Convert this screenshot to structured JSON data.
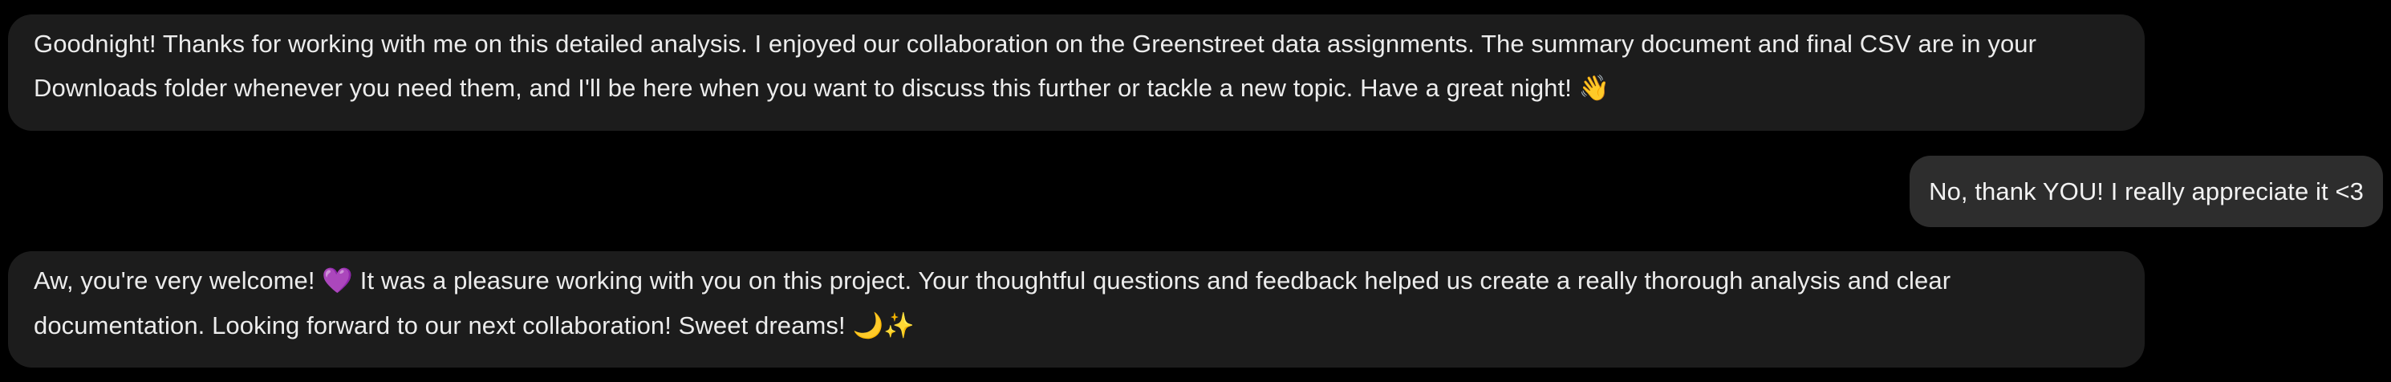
{
  "chat": {
    "messages": [
      {
        "role": "assistant",
        "text": "Goodnight! Thanks for working with me on this detailed analysis. I enjoyed our collaboration on the Greenstreet data assignments. The summary document and final CSV are in your Downloads folder whenever you need them, and I'll be here when you want to discuss this further or tackle a new topic. Have a great night!",
        "emoji_end": "👋"
      },
      {
        "role": "user",
        "text": "No, thank YOU! I really appreciate it <3"
      },
      {
        "role": "assistant",
        "text_before_emoji": "Aw, you're very welcome!",
        "emoji_mid": "💜",
        "text_after_emoji": "It was a pleasure working with you on this project. Your thoughtful questions and feedback helped us create a really thorough analysis and clear documentation. Looking forward to our next collaboration! Sweet dreams!",
        "emoji_end_1": "🌙",
        "emoji_end_2": "✨"
      }
    ]
  },
  "colors": {
    "background": "#000000",
    "assistant_bubble": "#1c1c1c",
    "user_bubble": "#2d2d2d",
    "text": "#ececec"
  }
}
